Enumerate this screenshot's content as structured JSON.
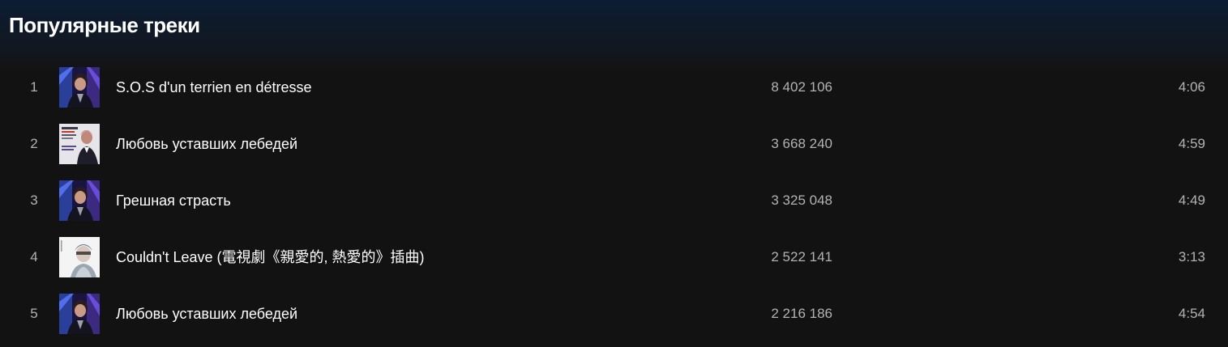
{
  "section": {
    "title": "Популярные треки"
  },
  "tracks": [
    {
      "number": "1",
      "title": "S.O.S d'un terrien en détresse",
      "plays": "8 402 106",
      "duration": "4:06",
      "cover": "album-cover-blue"
    },
    {
      "number": "2",
      "title": "Любовь уставших лебедей",
      "plays": "3 668 240",
      "duration": "4:59",
      "cover": "album-cover-suit"
    },
    {
      "number": "3",
      "title": "Грешная страсть",
      "plays": "3 325 048",
      "duration": "4:49",
      "cover": "album-cover-blue"
    },
    {
      "number": "4",
      "title": "Couldn't Leave (電視劇《親愛的, 熱愛的》插曲)",
      "plays": "2 522 141",
      "duration": "3:13",
      "cover": "album-cover-white"
    },
    {
      "number": "5",
      "title": "Любовь уставших лебедей",
      "plays": "2 216 186",
      "duration": "4:54",
      "cover": "album-cover-blue"
    }
  ]
}
